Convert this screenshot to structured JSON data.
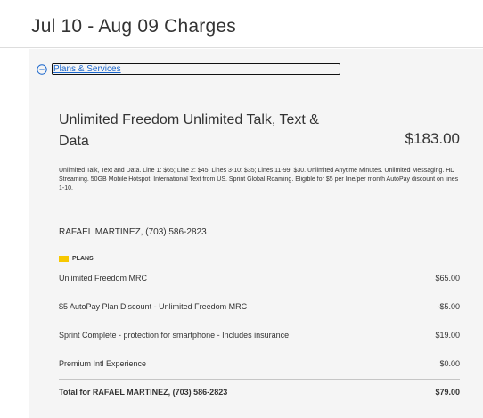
{
  "header": {
    "title": "Jul 10 - Aug 09 Charges"
  },
  "section": {
    "toggle_label": "Plans & Services"
  },
  "plan": {
    "title": "Unlimited Freedom Unlimited Talk, Text & Data",
    "price": "$183.00",
    "description": "Unlimited Talk, Text and Data. Line 1: $65; Line 2: $45; Lines 3-10: $35; Lines 11-99: $30. Unlimited Anytime Minutes. Unlimited Messaging. HD Streaming. 50GB Mobile Hotspot. International Text from US. Sprint Global Roaming. Eligible for $5 per line/per month AutoPay discount on lines 1-10."
  },
  "subscriber": {
    "line": "RAFAEL MARTINEZ, (703) 586-2823"
  },
  "plans_badge": {
    "label": "PLANS",
    "color": "#f7c800"
  },
  "items": [
    {
      "name": "Unlimited Freedom MRC",
      "amount": "$65.00"
    },
    {
      "name": "$5 AutoPay Plan Discount - Unlimited Freedom MRC",
      "amount": "-$5.00"
    },
    {
      "name": "Sprint Complete - protection for smartphone - Includes insurance",
      "amount": "$19.00"
    },
    {
      "name": "Premium Intl Experience",
      "amount": "$0.00"
    }
  ],
  "total": {
    "label": "Total for RAFAEL MARTINEZ, (703) 586-2823",
    "amount": "$79.00"
  },
  "colors": {
    "link": "#1a66cc",
    "panel_background": "#f5f5f5",
    "badge": "#f7c800"
  }
}
